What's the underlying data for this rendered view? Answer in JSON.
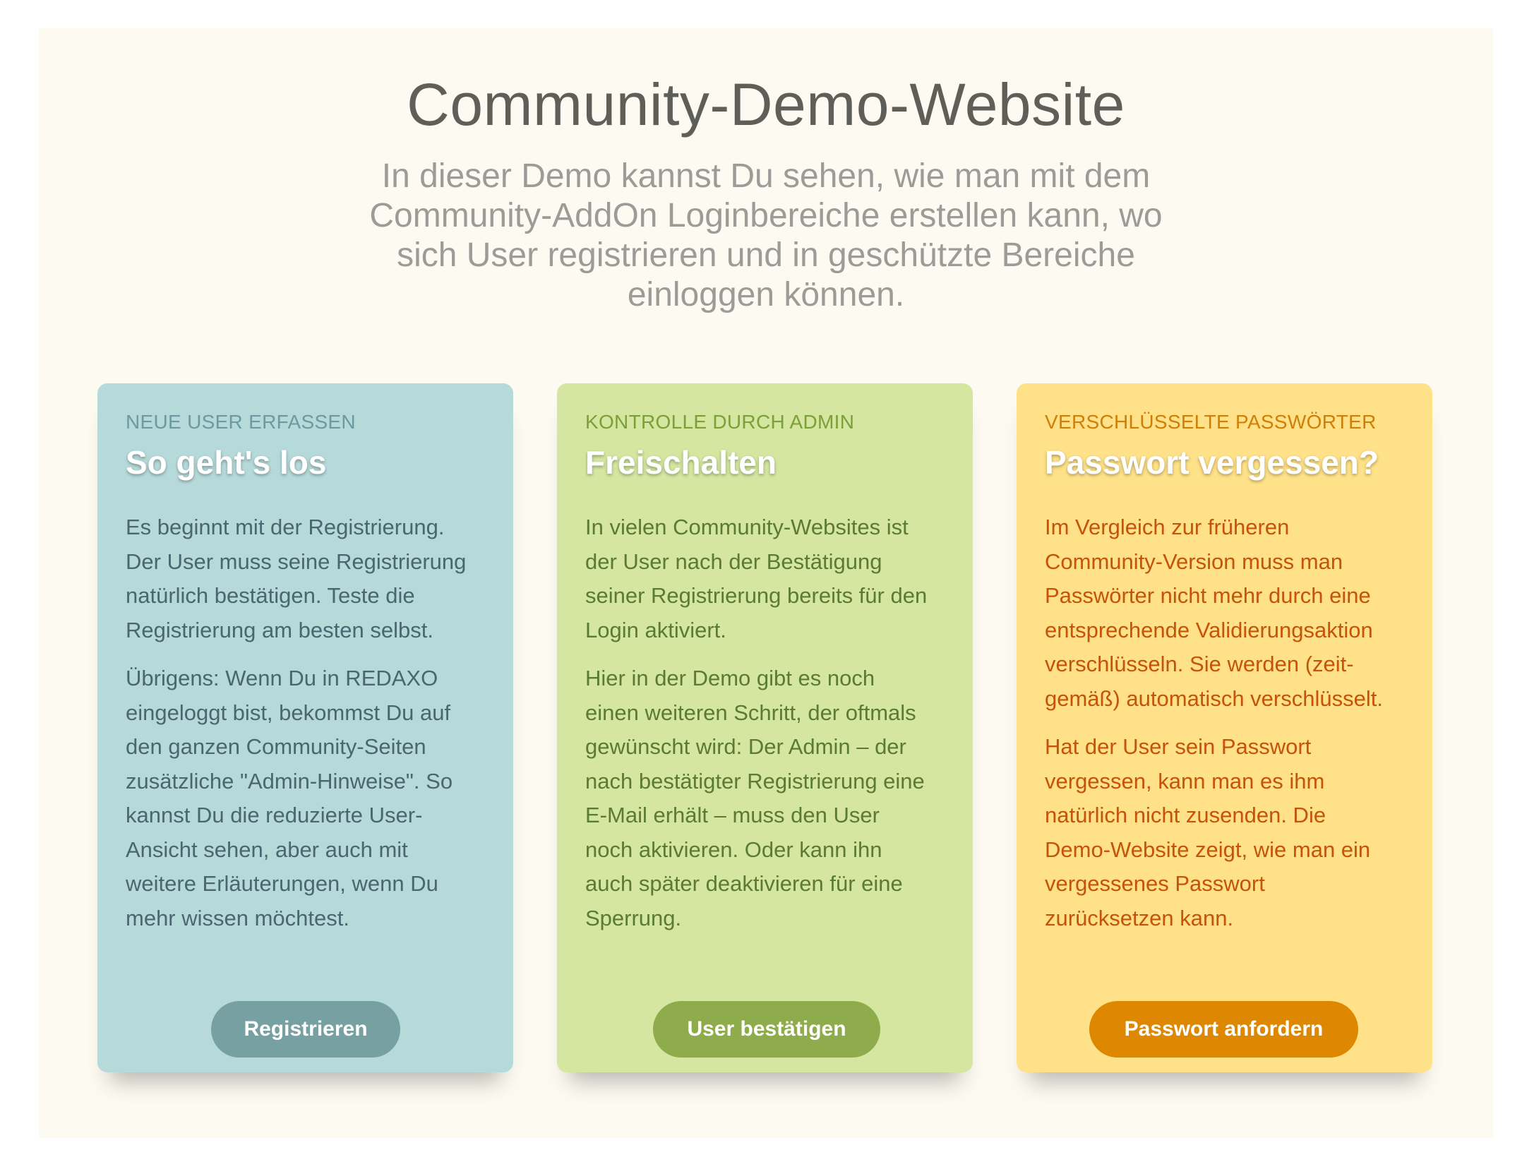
{
  "hero": {
    "title": "Community-Demo-Website",
    "lead_lines": [
      "In dieser Demo kannst Du sehen, wie man mit dem",
      "Community-AddOn Loginbereiche erstellen kann, wo",
      "sich User registrieren und in geschützte Bereiche",
      "einloggen können."
    ]
  },
  "cards": [
    {
      "kicker": "NEUE USER ERFASSEN",
      "title": "So geht's los",
      "paragraphs": [
        [
          "Es beginnt mit der Registrierung.",
          "Der User muss seine Registrierung",
          "natürlich bestätigen. Teste die",
          "Registrierung am besten selbst."
        ],
        [
          "Übrigens: Wenn Du in REDAXO",
          "eingeloggt bist, bekommst Du auf",
          "den ganzen Community-Seiten",
          "zusätzliche \"Admin-Hinweise\". So",
          "kannst Du die reduzierte User-",
          "Ansicht sehen, aber auch mit",
          "weitere Erläuterungen, wenn Du",
          "mehr wissen möchtest."
        ]
      ],
      "button_label": "Registrieren",
      "colors": {
        "background": "#b6d9d9",
        "button": "#77a0a3",
        "text": "#4a6670"
      }
    },
    {
      "kicker": "KONTROLLE DURCH ADMIN",
      "title": "Freischalten",
      "paragraphs": [
        [
          "In vielen Community-Websites ist",
          "der User nach der Bestätigung",
          "seiner Registrierung bereits für den",
          "Login aktiviert."
        ],
        [
          "Hier in der Demo gibt es noch",
          "einen weiteren Schritt, der oftmals",
          "gewünscht wird: Der Admin – der",
          "nach bestätigter Registrierung eine",
          "E-Mail erhält – muss den User",
          "noch aktivieren. Oder kann ihn",
          "auch später deaktivieren für eine",
          "Sperrung."
        ]
      ],
      "button_label": "User bestätigen",
      "colors": {
        "background": "#d4e69f",
        "button": "#8eac4b",
        "text": "#5a7a35"
      }
    },
    {
      "kicker": "VERSCHLÜSSELTE PASSWÖRTER",
      "title": "Passwort vergessen?",
      "paragraphs": [
        [
          "Im Vergleich zur früheren",
          "Community-Version muss man",
          "Passwörter nicht mehr durch eine",
          "entsprechende Validierungsaktion",
          "verschlüsseln. Sie werden (zeit-",
          "gemäß) automatisch verschlüsselt."
        ],
        [
          "Hat der User sein Passwort",
          "vergessen, kann man es ihm",
          "natürlich nicht zusenden. Die",
          "Demo-Website zeigt, wie man ein",
          "vergessenes Passwort",
          "zurücksetzen kann."
        ]
      ],
      "button_label": "Passwort anfordern",
      "colors": {
        "background": "#fee188",
        "button": "#dd8800",
        "text": "#c5530a"
      }
    }
  ]
}
